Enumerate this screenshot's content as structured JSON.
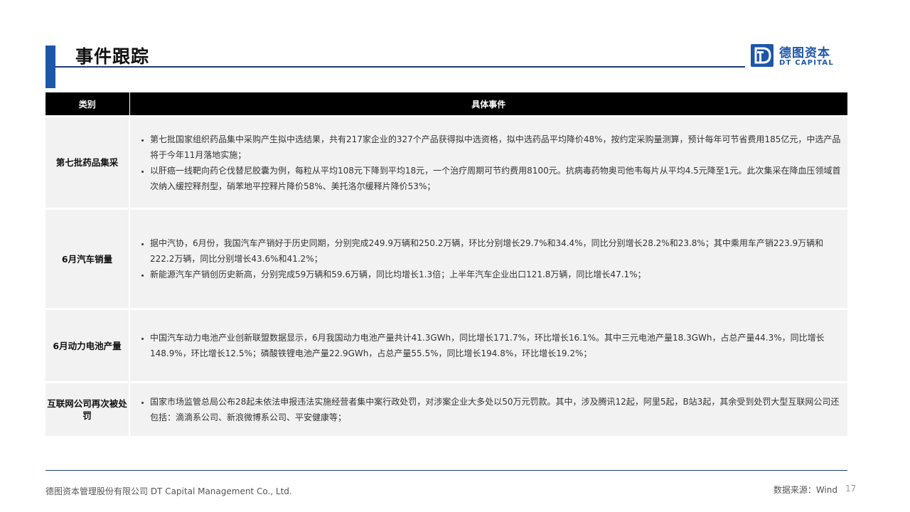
{
  "header": {
    "title": "事件跟踪",
    "logo_cn": "德图资本",
    "logo_en": "DT CAPITAL"
  },
  "table": {
    "columns": [
      "类别",
      "具体事件"
    ],
    "rows": [
      {
        "category": "第七批药品集采",
        "items": [
          "第七批国家组织药品集中采购产生拟中选结果，共有217家企业的327个产品获得拟中选资格，拟中选药品平均降价48%，按约定采购量测算，预计每年可节省费用185亿元，中选产品将于今年11月落地实施；",
          "以肝癌一线靶向药仑伐替尼胶囊为例，每粒从平均108元下降到平均18元，一个治疗周期可节约费用8100元。抗病毒药物奥司他韦每片从平均4.5元降至1元。此次集采在降血压领域首次纳入缓控释剂型，硝苯地平控释片降价58%、美托洛尔缓释片降价53%；"
        ]
      },
      {
        "category": "6月汽车销量",
        "items": [
          "据中汽协，6月份，我国汽车产销好于历史同期，分别完成249.9万辆和250.2万辆，环比分别增长29.7%和34.4%，同比分别增长28.2%和23.8%；其中乘用车产销223.9万辆和222.2万辆，同比分别增长43.6%和41.2%；",
          "新能源汽车产销创历史新高，分别完成59万辆和59.6万辆，同比均增长1.3倍；上半年汽车企业出口121.8万辆，同比增长47.1%；"
        ]
      },
      {
        "category": "6月动力电池产量",
        "items": [
          "中国汽车动力电池产业创新联盟数据显示，6月我国动力电池产量共计41.3GWh，同比增长171.7%，环比增长16.1%。其中三元电池产量18.3GWh，占总产量44.3%，同比增长148.9%，环比增长12.5%；磷酸铁锂电池产量22.9GWh，占总产量55.5%，同比增长194.8%，环比增长19.2%；"
        ]
      },
      {
        "category": "互联网公司再次被处罚",
        "items": [
          "国家市场监管总局公布28起未依法申报违法实施经营者集中案行政处罚，对涉案企业大多处以50万元罚款。其中，涉及腾讯12起，阿里5起，B站3起，其余受到处罚大型互联网公司还包括：滴滴系公司、新浪微博系公司、平安健康等；"
        ]
      }
    ]
  },
  "footer": {
    "company": "德图资本管理股份有限公司  DT Capital  Management  Co., Ltd.",
    "source": "数据来源：Wind",
    "page": "17"
  },
  "colors": {
    "brand_blue": "#1e56a8",
    "header_bg": "#000000",
    "row_bg": "#f2f2f2"
  }
}
